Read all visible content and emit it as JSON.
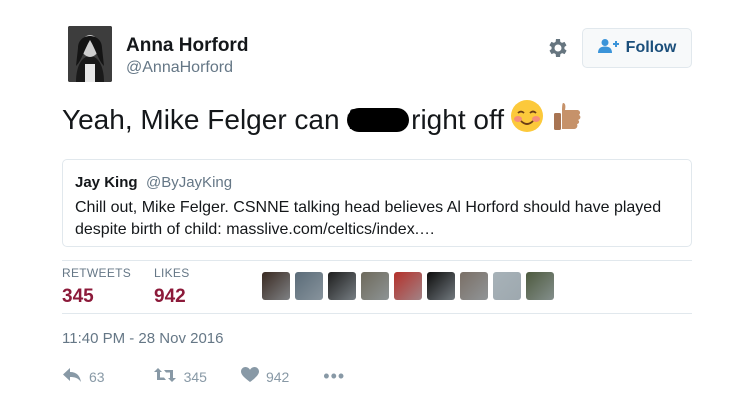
{
  "author": {
    "name": "Anna Horford",
    "handle": "@AnnaHorford"
  },
  "follow_button": {
    "label": "Follow",
    "icon": "add-user-icon"
  },
  "settings": {
    "icon": "gear-icon"
  },
  "tweet": {
    "text_before": "Yeah, Mike Felger can f",
    "text_after": "right off",
    "emojis": [
      "smiling-blushing-face",
      "thumbs-up"
    ]
  },
  "quoted_tweet": {
    "name": "Jay King",
    "handle": "@ByJayKing",
    "text": "Chill out, Mike Felger. CSNNE talking head believes Al Horford should have played despite birth of child: masslive.com/celtics/index.…"
  },
  "stats": {
    "retweets_label": "RETWEETS",
    "retweets_value": "345",
    "likes_label": "LIKES",
    "likes_value": "942"
  },
  "liker_avatars": [
    "#3a2a22",
    "#5a6b78",
    "#1e1e1e",
    "#6e6a5c",
    "#b5302a",
    "#0d0d0d",
    "#7a6f66",
    "#a7b2b8",
    "#4d5a3e"
  ],
  "timestamp": "11:40 PM - 28 Nov 2016",
  "actions": {
    "reply_count": "63",
    "retweet_count": "345",
    "like_count": "942"
  },
  "colors": {
    "stat_value": "#8c1a3a",
    "follow_text": "#1b4f7b",
    "muted": "#657786"
  }
}
